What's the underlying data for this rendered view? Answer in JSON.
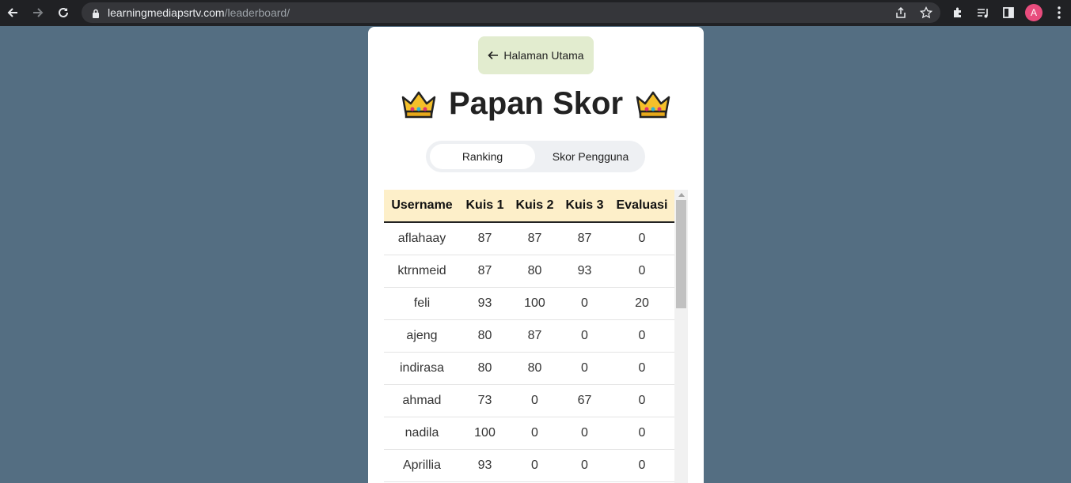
{
  "browser": {
    "url_host": "learningmediapsrtv.com",
    "url_path": "/leaderboard/",
    "profile_initial": "A"
  },
  "page": {
    "home_button": "Halaman Utama",
    "title": "Papan Skor",
    "tabs": {
      "ranking": "Ranking",
      "user_scores": "Skor Pengguna"
    },
    "active_tab": "Ranking"
  },
  "table": {
    "headers": [
      "Username",
      "Kuis 1",
      "Kuis 2",
      "Kuis 3",
      "Evaluasi"
    ],
    "rows": [
      [
        "aflahaay",
        "87",
        "87",
        "87",
        "0"
      ],
      [
        "ktrnmeid",
        "87",
        "80",
        "93",
        "0"
      ],
      [
        "feli",
        "93",
        "100",
        "0",
        "20"
      ],
      [
        "ajeng",
        "80",
        "87",
        "0",
        "0"
      ],
      [
        "indirasa",
        "80",
        "80",
        "0",
        "0"
      ],
      [
        "ahmad",
        "73",
        "0",
        "67",
        "0"
      ],
      [
        "nadila",
        "100",
        "0",
        "0",
        "0"
      ],
      [
        "Aprillia",
        "93",
        "0",
        "0",
        "0"
      ]
    ]
  },
  "colors": {
    "page_background": "#546e82",
    "header_background": "#fdefc9",
    "home_button_background": "#e2eccf",
    "avatar": "#e84c7d"
  }
}
